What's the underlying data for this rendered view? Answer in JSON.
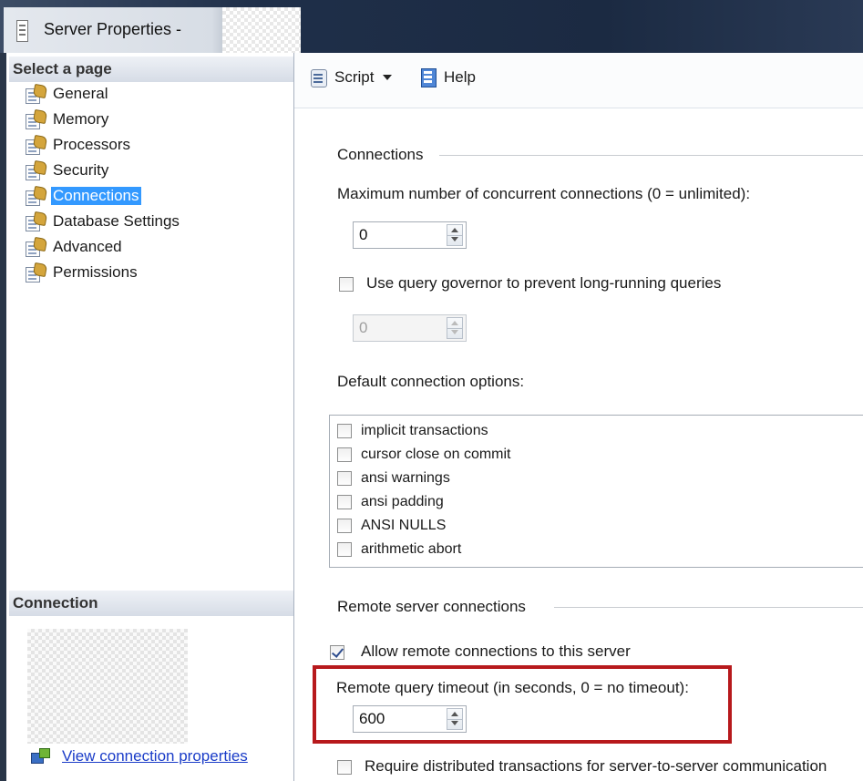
{
  "window": {
    "title": "Server Properties -"
  },
  "left_pane": {
    "select_page_heading": "Select a page",
    "pages": [
      {
        "label": "General",
        "selected": false
      },
      {
        "label": "Memory",
        "selected": false
      },
      {
        "label": "Processors",
        "selected": false
      },
      {
        "label": "Security",
        "selected": false
      },
      {
        "label": "Connections",
        "selected": true
      },
      {
        "label": "Database Settings",
        "selected": false
      },
      {
        "label": "Advanced",
        "selected": false
      },
      {
        "label": "Permissions",
        "selected": false
      }
    ],
    "connection_heading": "Connection",
    "view_connection_properties": "View connection properties"
  },
  "toolbar": {
    "script_label": "Script",
    "help_label": "Help"
  },
  "connections": {
    "group_label": "Connections",
    "max_connections_label": "Maximum number of concurrent connections (0 = unlimited):",
    "max_connections_value": "0",
    "query_governor_label": "Use query governor to prevent long-running queries",
    "query_governor_checked": false,
    "query_governor_value": "0",
    "default_options_label": "Default connection options:",
    "options": [
      {
        "label": "implicit transactions",
        "checked": false
      },
      {
        "label": "cursor close on commit",
        "checked": false
      },
      {
        "label": "ansi warnings",
        "checked": false
      },
      {
        "label": "ansi padding",
        "checked": false
      },
      {
        "label": "ANSI NULLS",
        "checked": false
      },
      {
        "label": "arithmetic abort",
        "checked": false
      }
    ]
  },
  "remote": {
    "group_label": "Remote server connections",
    "allow_remote_label": "Allow remote connections to this server",
    "allow_remote_checked": true,
    "timeout_label": "Remote query timeout (in seconds, 0 = no timeout):",
    "timeout_value": "600",
    "require_distributed_label": "Require distributed transactions for server-to-server communication",
    "require_distributed_checked": false
  },
  "colors": {
    "selection": "#3399ff",
    "highlight_border": "#b7191c",
    "link": "#1a3cc8"
  }
}
